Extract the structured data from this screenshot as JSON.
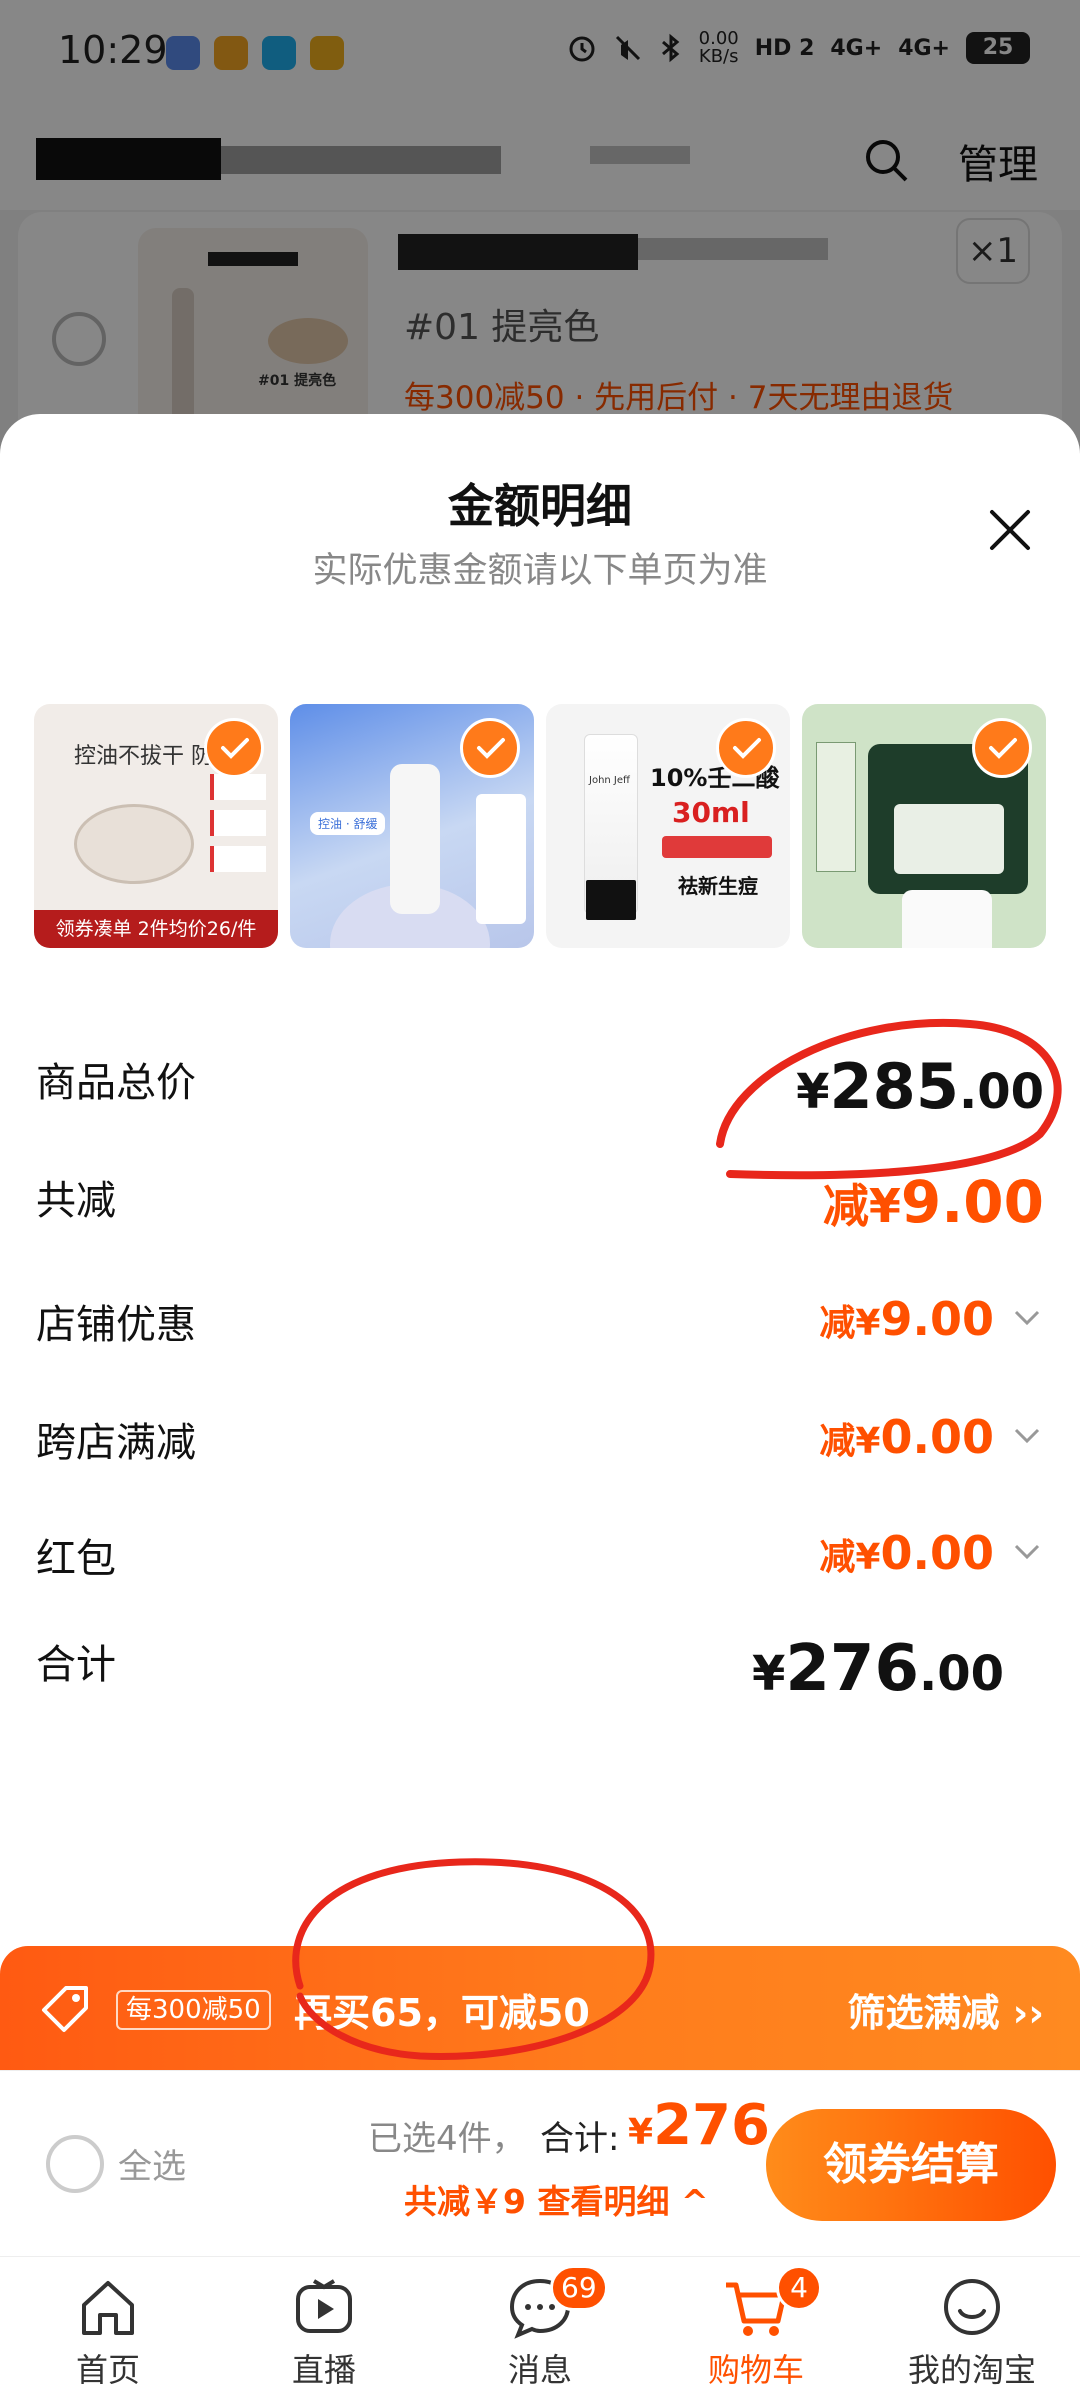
{
  "status_bar": {
    "time": "10:29",
    "net_speed": "0.00",
    "net_unit": "KB/s",
    "hd": "HD 2",
    "sig1": "4G+",
    "sig2": "4G+",
    "battery": "25"
  },
  "header": {
    "manage_label": "管理",
    "search_icon": "search-icon"
  },
  "cart_item": {
    "thumb_label": "#01 提亮色",
    "variant": "#01 提亮色",
    "promo": "每300减50 · 先用后付 · 7天无理由退货",
    "quantity": "×1"
  },
  "sheet": {
    "title": "金额明细",
    "subtitle": "实际优惠金额请以下单页为准",
    "thumbs": [
      {
        "name": "powder",
        "caption": "领券凑单 2件均价26/件",
        "top_text": "控油不拔干 防水"
      },
      {
        "name": "toner",
        "badge": "控油 · 舒缓"
      },
      {
        "name": "serum",
        "brand": "John Jeff",
        "headline": "10%壬二酸",
        "volume": "30ml",
        "effect": "祛新生痘"
      },
      {
        "name": "tissue"
      }
    ],
    "rows": {
      "subtotal": {
        "label": "商品总价",
        "currency": "¥",
        "int": "285",
        "dec": ".00"
      },
      "total_discount": {
        "label": "共减",
        "prefix": "减¥",
        "int": "9",
        "dec": ".00"
      },
      "shop_discount": {
        "label": "店铺优惠",
        "prefix": "减¥",
        "int": "9",
        "dec": ".00"
      },
      "cross_store": {
        "label": "跨店满减",
        "prefix": "减¥",
        "int": "0",
        "dec": ".00"
      },
      "red_packet": {
        "label": "红包",
        "prefix": "减¥",
        "int": "0",
        "dec": ".00"
      },
      "total": {
        "label": "合计",
        "currency": "¥",
        "int": "276",
        "dec": ".00"
      }
    }
  },
  "promo_strip": {
    "pill": "每300减50",
    "text": "再买65，可减50",
    "filter": "筛选满减 ››"
  },
  "checkout": {
    "select_all": "全选",
    "selected": "已选4件，",
    "sum_label": "合计:",
    "currency": "¥",
    "amount": "276",
    "saving": "共减￥9 查看明细 ^",
    "pay_button": "领券结算"
  },
  "tabbar": {
    "tabs": [
      {
        "label": "首页",
        "icon": "home-icon"
      },
      {
        "label": "直播",
        "icon": "live-icon"
      },
      {
        "label": "消息",
        "icon": "message-icon",
        "badge": "69"
      },
      {
        "label": "购物车",
        "icon": "cart-icon",
        "badge": "4",
        "active": true
      },
      {
        "label": "我的淘宝",
        "icon": "profile-icon"
      }
    ]
  },
  "colors": {
    "accent": "#ff5000",
    "accent_light": "#ff8a20",
    "annotation": "#e8271b"
  }
}
